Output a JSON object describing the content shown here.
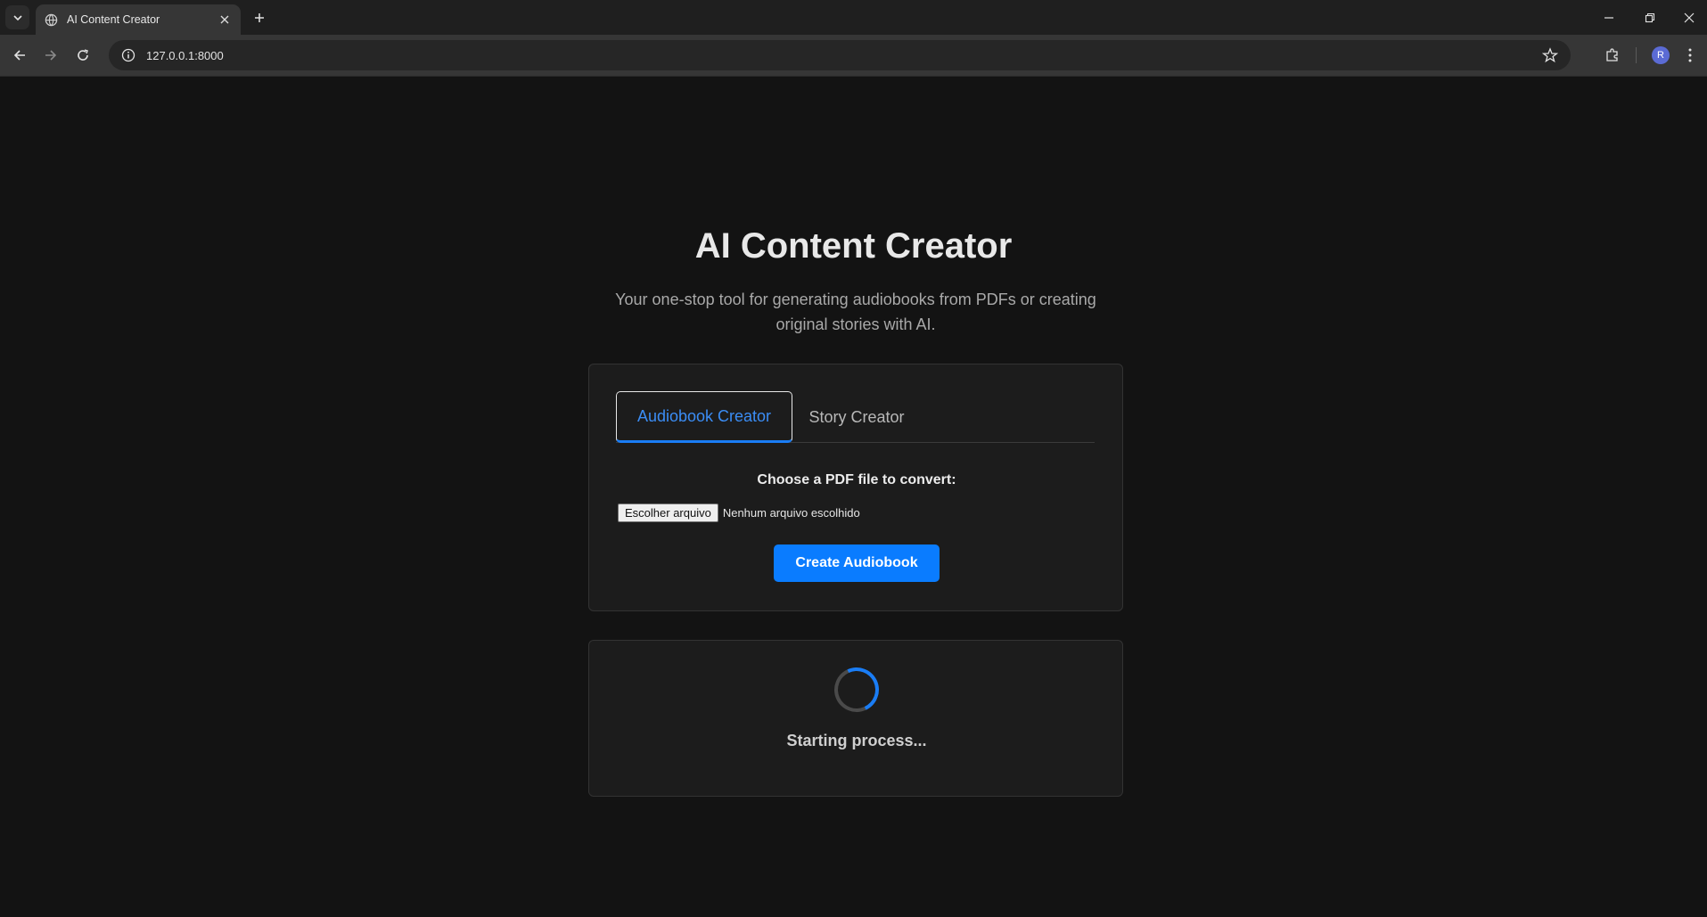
{
  "browser": {
    "tab_title": "AI Content Creator",
    "url": "127.0.0.1:8000",
    "profile_initial": "R"
  },
  "page": {
    "heading": "AI Content Creator",
    "subtitle": "Your one-stop tool for generating audiobooks from PDFs or creating original stories with AI.",
    "tabs": [
      {
        "label": "Audiobook Creator",
        "active": true
      },
      {
        "label": "Story Creator",
        "active": false
      }
    ],
    "form": {
      "file_label": "Choose a PDF file to convert:",
      "file_button": "Escolher arquivo",
      "file_status": "Nenhum arquivo escolhido",
      "submit_label": "Create Audiobook"
    },
    "status": {
      "message": "Starting process..."
    }
  },
  "colors": {
    "accent": "#0a7cff",
    "background": "#131313",
    "card": "#1c1c1c"
  }
}
